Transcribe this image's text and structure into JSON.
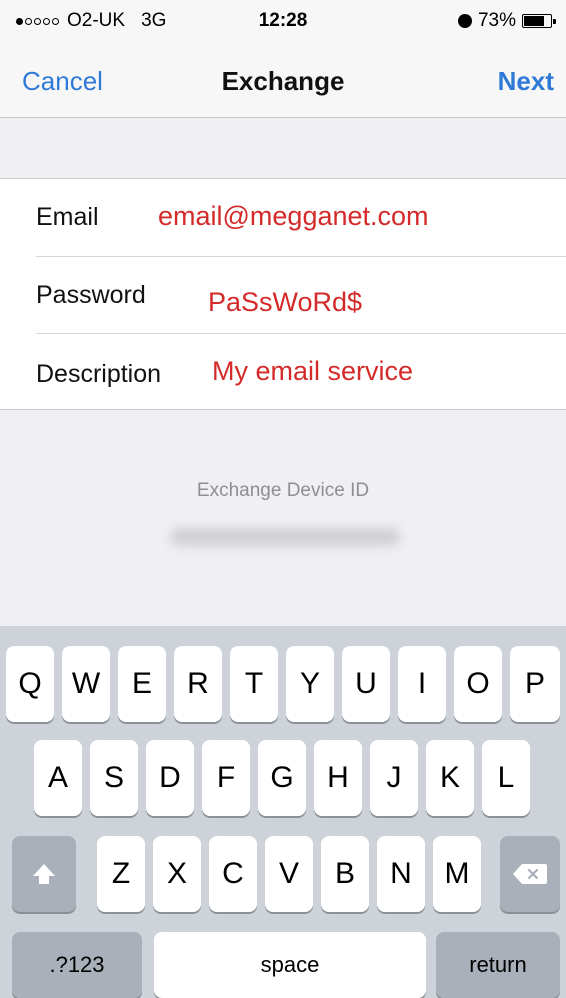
{
  "status_bar": {
    "carrier": "O2-UK",
    "network": "3G",
    "time": "12:28",
    "battery_percent": "73%",
    "signal_filled_dots": 1,
    "signal_total_dots": 5,
    "battery_level": 0.73
  },
  "navbar": {
    "cancel_label": "Cancel",
    "title": "Exchange",
    "next_label": "Next"
  },
  "form": {
    "rows": [
      {
        "label": "Email",
        "value": "email@megganet.com"
      },
      {
        "label": "Password",
        "value": "PaSsWoRd$"
      },
      {
        "label": "Description",
        "value": "My email service"
      }
    ]
  },
  "device": {
    "label": "Exchange Device ID"
  },
  "keyboard": {
    "row1": [
      "Q",
      "W",
      "E",
      "R",
      "T",
      "Y",
      "U",
      "I",
      "O",
      "P"
    ],
    "row2": [
      "A",
      "S",
      "D",
      "F",
      "G",
      "H",
      "J",
      "K",
      "L"
    ],
    "row3": [
      "Z",
      "X",
      "C",
      "V",
      "B",
      "N",
      "M"
    ],
    "numbers_label": ".?123",
    "space_label": "space",
    "return_label": "return"
  },
  "colors": {
    "accent": "#2f7ad6",
    "value_text": "#d42a2a",
    "keyboard_bg": "#ced2d9"
  },
  "icons": [
    "alarm-icon",
    "battery-icon",
    "shift-icon",
    "delete-icon"
  ]
}
